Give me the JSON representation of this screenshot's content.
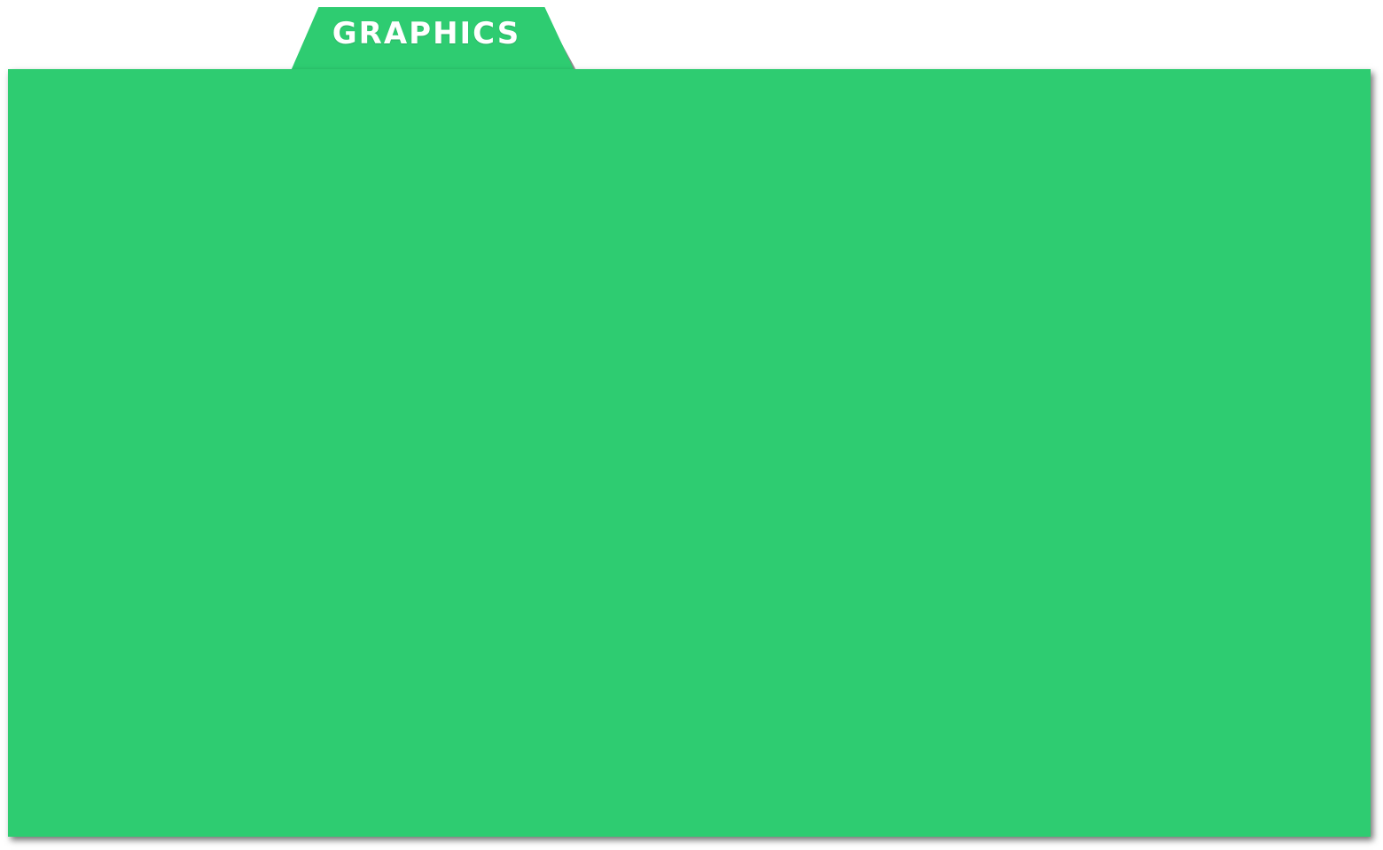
{
  "tab": {
    "label": "GRAPHICS"
  },
  "colors": {
    "folder_green": "#2ecc71",
    "label_white": "#ffffff",
    "background": "#ffffff"
  }
}
